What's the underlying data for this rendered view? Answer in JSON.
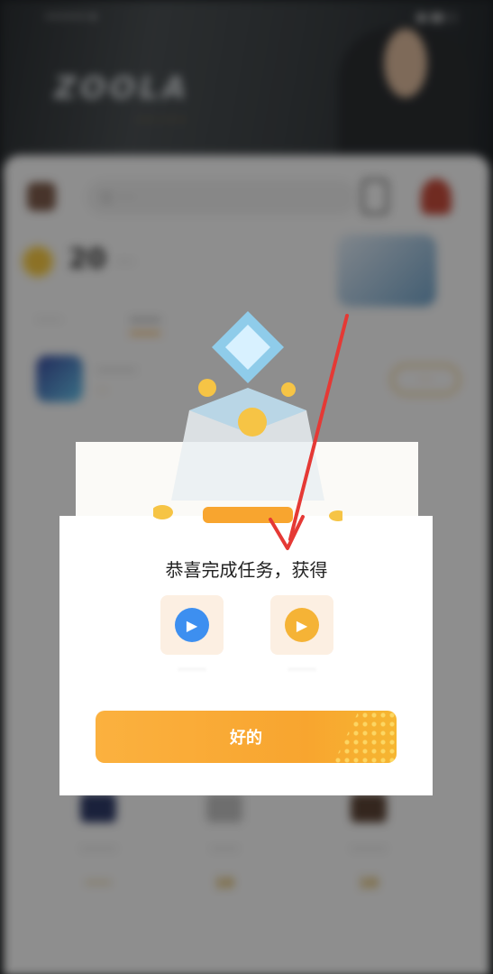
{
  "status_bar": {
    "left": "•••••• ▾",
    "right": "▣ ▮▮ ◻"
  },
  "banner": {
    "title": "ZOOLA",
    "subtitle": "·····  ······"
  },
  "header": {
    "search_placeholder": "Q  ·····"
  },
  "wallet": {
    "coins": "20",
    "unit": "·····"
  },
  "tabs": {
    "first": "······",
    "second": "······"
  },
  "task_item": {
    "title": "·········",
    "subtitle": "···",
    "action": "···"
  },
  "grid": [
    {
      "label": "·········",
      "coin": "·····"
    },
    {
      "label": "·······",
      "coin": "10"
    },
    {
      "label": "·········",
      "coin": "10"
    }
  ],
  "dialog": {
    "title": "恭喜完成任务，获得",
    "rewards": [
      {
        "label": "·········",
        "color": "#3d8ff0"
      },
      {
        "label": "·········",
        "color": "#f5b336"
      }
    ],
    "ok_label": "好的"
  },
  "colors": {
    "accent": "#f8a52f",
    "arrow": "#e53935"
  }
}
